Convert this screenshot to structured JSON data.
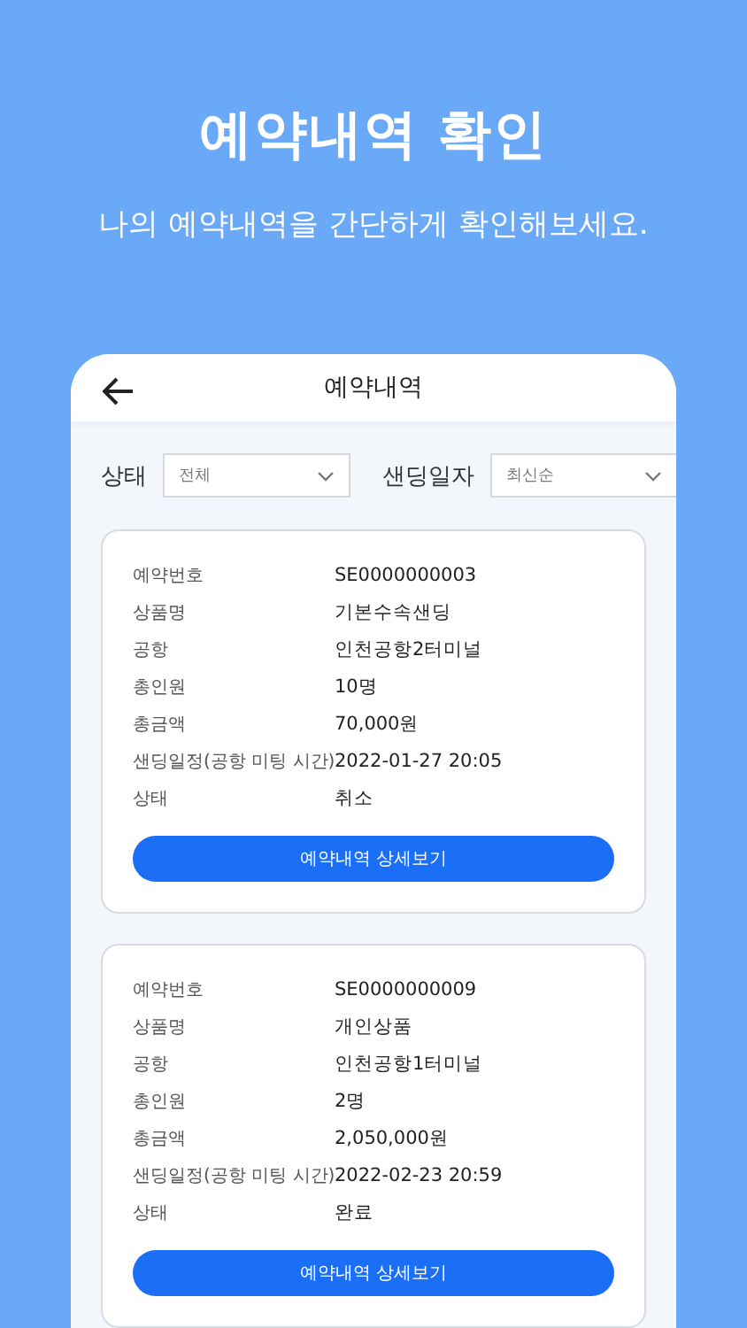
{
  "headline": "예약내역 확인",
  "subtitle": "나의 예약내역을 간단하게 확인해보세요.",
  "header": {
    "title": "예약내역"
  },
  "filters": [
    {
      "label": "상태",
      "value": "전체"
    },
    {
      "label": "샌딩일자",
      "value": "최신순"
    }
  ],
  "reservations": [
    {
      "rows": [
        {
          "label": "예약번호",
          "value": "SE0000000003"
        },
        {
          "label": "상품명",
          "value": "기본수속샌딩"
        },
        {
          "label": "공항",
          "value": "인천공항2터미널"
        },
        {
          "label": "총인원",
          "value": "10명"
        },
        {
          "label": "총금액",
          "value": "70,000원"
        },
        {
          "label": "샌딩일정(공항 미팅 시간)",
          "value": "2022-01-27 20:05"
        },
        {
          "label": "상태",
          "value": "취소"
        }
      ],
      "button": "예약내역 상세보기"
    },
    {
      "rows": [
        {
          "label": "예약번호",
          "value": "SE0000000009"
        },
        {
          "label": "상품명",
          "value": "개인상품"
        },
        {
          "label": "공항",
          "value": "인천공항1터미널"
        },
        {
          "label": "총인원",
          "value": "2명"
        },
        {
          "label": "총금액",
          "value": "2,050,000원"
        },
        {
          "label": "샌딩일정(공항 미팅 시간)",
          "value": "2022-02-23 20:59"
        },
        {
          "label": "상태",
          "value": "완료"
        }
      ],
      "button": "예약내역 상세보기"
    }
  ]
}
